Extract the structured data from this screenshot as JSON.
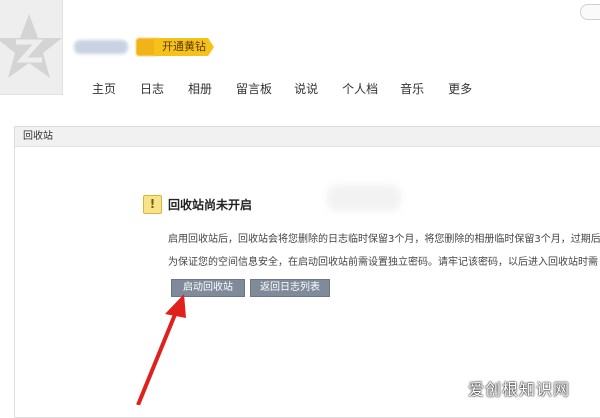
{
  "header": {
    "vip_label": "开通黄钻",
    "nav": [
      "主页",
      "日志",
      "相册",
      "留言板",
      "说说",
      "个人档",
      "音乐",
      "更多"
    ]
  },
  "panel": {
    "title": "回收站",
    "notice_title": "回收站尚未开启",
    "desc_line1": "启用回收站后，回收站会将您删除的日志临时保留3个月，将您删除的相册临时保留3个月，过期后",
    "desc_line2": "为保证您的空间信息安全，在启动回收站前需设置独立密码。请牢记该密码，以后进入回收站时需",
    "button_enable": "启动回收站",
    "button_back": "返回日志列表"
  },
  "watermark": "爱创根知识网",
  "colors": {
    "vip_yellow": "#f6c21a",
    "button_gray": "#7f8a9a",
    "arrow_red": "#e0201c"
  },
  "icons": {
    "avatar": "qzone-star-avatar",
    "notice": "exclamation-icon",
    "arrow": "red-arrow-pointer"
  }
}
